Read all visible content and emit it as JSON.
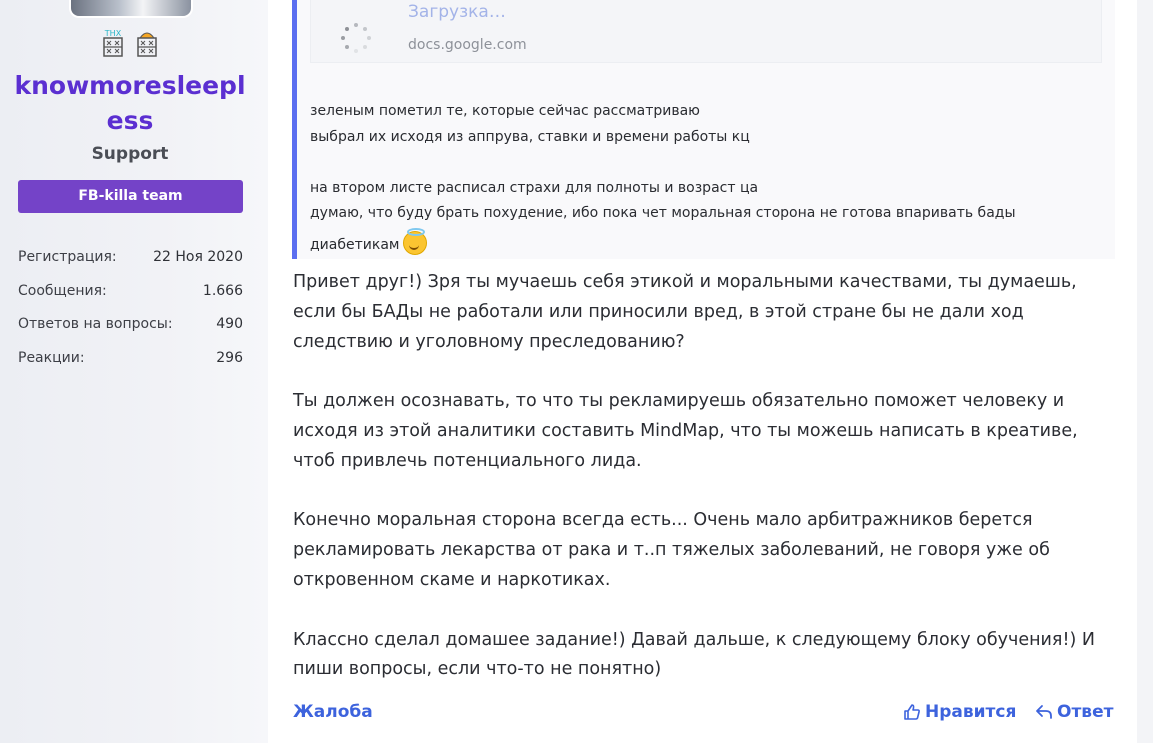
{
  "sidebar": {
    "badges": [
      "THX"
    ],
    "username": "knowmoresleepl ess",
    "user_title": "Support",
    "team_banner": "FB-killa team",
    "stats": [
      {
        "label": "Регистрация:",
        "value": "22 Ноя 2020"
      },
      {
        "label": "Сообщения:",
        "value": "1.666"
      },
      {
        "label": "Ответов на вопросы:",
        "value": "490"
      },
      {
        "label": "Реакции:",
        "value": "296"
      }
    ]
  },
  "quote": {
    "embed_title": "Загрузка…",
    "embed_url": "docs.google.com",
    "lines": [
      "зеленым пометил те, которые сейчас рассматриваю",
      "выбрал их исходя из аппрува, ставки и времени работы кц",
      "на втором листе расписал страхи для полноты и возраст ца",
      "думаю, что буду брать похудение, ибо пока чет моральная сторона не готова впаривать бады",
      "диабетикам"
    ],
    "emoji": "smiling-face-with-halo"
  },
  "post": {
    "paragraphs": [
      "Привет друг!) Зря ты мучаешь себя этикой и моральными качествами, ты думаешь, если бы БАДы не работали или приносили вред, в этой стране бы не дали ход следствию и уголовному преследованию?",
      "Ты должен осознавать, то что ты рекламируешь обязательно поможет человеку и исходя из этой аналитики составить MindMap, что ты можешь написать в креативе, чтоб привлечь потенциального лида.",
      "Конечно моральная сторона всегда есть... Очень мало арбитражников берется рекламировать лекарства от рака и т..п тяжелых заболеваний, не говоря уже об откровенном скаме и наркотиках.",
      "Классно сделал домашее задание!) Давай дальше, к следующему блоку обучения!) И пиши вопросы, если что-то не понятно)"
    ]
  },
  "actions": {
    "report": "Жалоба",
    "like": "Нравится",
    "reply": "Ответ"
  },
  "colors": {
    "accent": "#3d63dd",
    "username": "#5b2fd1",
    "banner": "#7443c8",
    "quote_border": "#5b6ef0"
  }
}
